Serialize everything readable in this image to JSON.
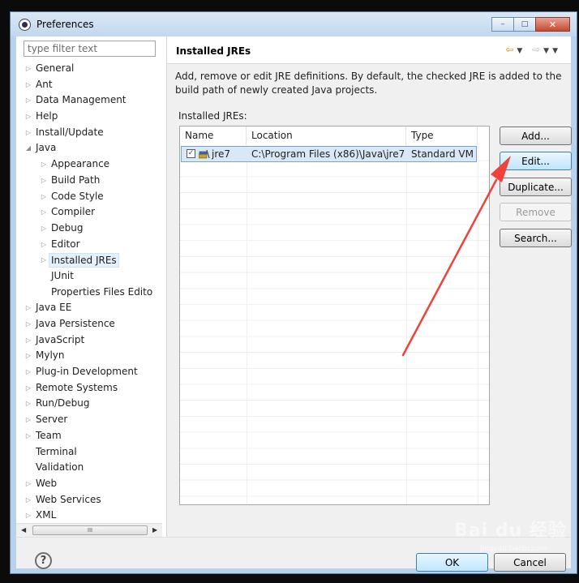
{
  "window": {
    "title": "Preferences",
    "minimize_glyph": "–",
    "maximize_glyph": "□",
    "close_glyph": "✕"
  },
  "filter": {
    "placeholder": "type filter text",
    "value": ""
  },
  "tree": {
    "items": [
      {
        "label": "General",
        "expander": "collapsed",
        "level": 0
      },
      {
        "label": "Ant",
        "expander": "collapsed",
        "level": 0
      },
      {
        "label": "Data Management",
        "expander": "collapsed",
        "level": 0
      },
      {
        "label": "Help",
        "expander": "collapsed",
        "level": 0
      },
      {
        "label": "Install/Update",
        "expander": "collapsed",
        "level": 0
      },
      {
        "label": "Java",
        "expander": "expanded",
        "level": 0
      },
      {
        "label": "Appearance",
        "expander": "collapsed",
        "level": 1
      },
      {
        "label": "Build Path",
        "expander": "collapsed",
        "level": 1
      },
      {
        "label": "Code Style",
        "expander": "collapsed",
        "level": 1
      },
      {
        "label": "Compiler",
        "expander": "collapsed",
        "level": 1
      },
      {
        "label": "Debug",
        "expander": "collapsed",
        "level": 1
      },
      {
        "label": "Editor",
        "expander": "collapsed",
        "level": 1
      },
      {
        "label": "Installed JREs",
        "expander": "collapsed",
        "level": 1,
        "selected": true
      },
      {
        "label": "JUnit",
        "expander": "none",
        "level": 1
      },
      {
        "label": "Properties Files Edito",
        "expander": "none",
        "level": 1
      },
      {
        "label": "Java EE",
        "expander": "collapsed",
        "level": 0
      },
      {
        "label": "Java Persistence",
        "expander": "collapsed",
        "level": 0
      },
      {
        "label": "JavaScript",
        "expander": "collapsed",
        "level": 0
      },
      {
        "label": "Mylyn",
        "expander": "collapsed",
        "level": 0
      },
      {
        "label": "Plug-in Development",
        "expander": "collapsed",
        "level": 0
      },
      {
        "label": "Remote Systems",
        "expander": "collapsed",
        "level": 0
      },
      {
        "label": "Run/Debug",
        "expander": "collapsed",
        "level": 0
      },
      {
        "label": "Server",
        "expander": "collapsed",
        "level": 0
      },
      {
        "label": "Team",
        "expander": "collapsed",
        "level": 0
      },
      {
        "label": "Terminal",
        "expander": "none",
        "level": 0
      },
      {
        "label": "Validation",
        "expander": "none",
        "level": 0
      },
      {
        "label": "Web",
        "expander": "collapsed",
        "level": 0
      },
      {
        "label": "Web Services",
        "expander": "collapsed",
        "level": 0
      },
      {
        "label": "XML",
        "expander": "collapsed",
        "level": 0
      }
    ],
    "scroll_thumb_glyph": "III"
  },
  "page": {
    "title": "Installed JREs",
    "description": "Add, remove or edit JRE definitions. By default, the checked JRE is added to the build path of newly created Java projects.",
    "table_label": "Installed JREs:"
  },
  "table": {
    "columns": [
      "Name",
      "Location",
      "Type"
    ],
    "rows": [
      {
        "checked": true,
        "name": "jre7",
        "location": "C:\\Program Files (x86)\\Java\\jre7",
        "type": "Standard VM"
      }
    ]
  },
  "buttons": {
    "add": "Add...",
    "edit": "Edit...",
    "duplicate": "Duplicate...",
    "remove": "Remove",
    "search": "Search...",
    "ok": "OK",
    "cancel": "Cancel"
  },
  "help_glyph": "?",
  "watermark": {
    "text": "Bai du 经验",
    "sub": "jingyan.baidu.com"
  },
  "colors": {
    "accent_arrow": "#f0413c",
    "selection": "#d9e8f7",
    "nav_arrow": "#d98e1b"
  }
}
